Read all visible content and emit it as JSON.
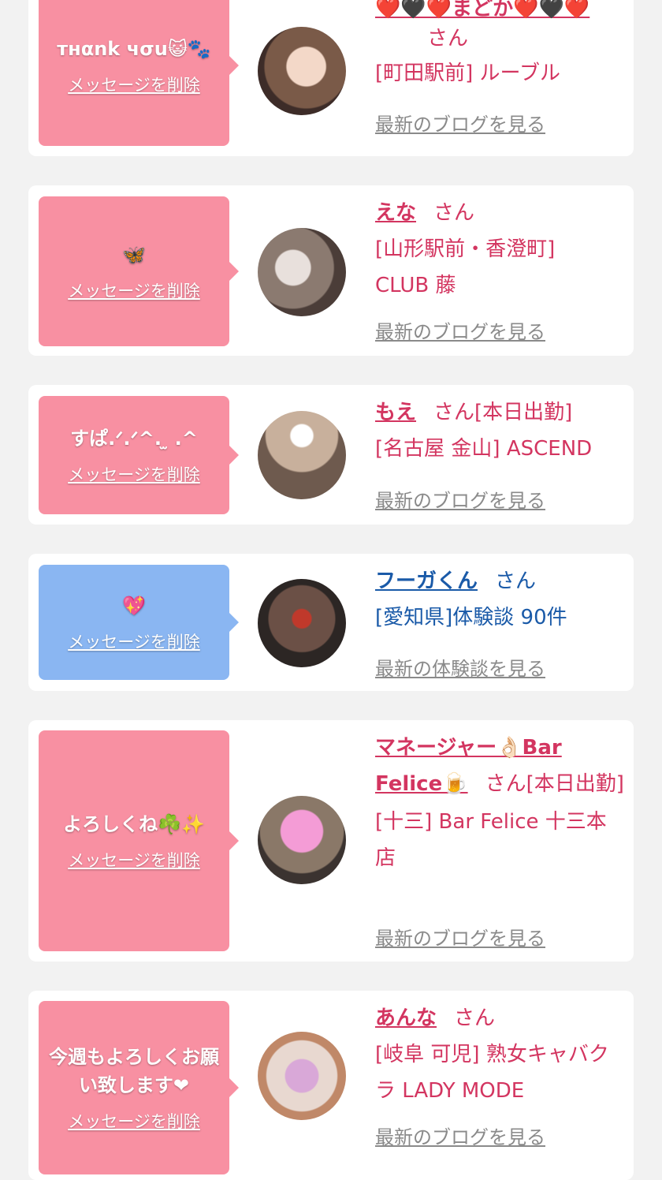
{
  "cards": [
    {
      "message": "тнαnk чσu😺🐾",
      "delete_label": "メッセージを削除",
      "name": "❤️🖤❤️まどか❤️🖤❤️",
      "honorific": "さん",
      "status": "",
      "shop": "[町田駅前] ルーブル",
      "link": "最新のブログを見る"
    },
    {
      "message": "🦋",
      "delete_label": "メッセージを削除",
      "name": "えな",
      "honorific": "さん",
      "status": "",
      "shop": "[山形駅前・香澄町] CLUB 藤",
      "link": "最新のブログを見る"
    },
    {
      "message": "すぱ.ᐟ.ᐟ^. ̫ .^",
      "delete_label": "メッセージを削除",
      "name": "もえ",
      "honorific": "さん",
      "status": "[本日出勤]",
      "shop": "[名古屋 金山] ASCEND",
      "link": "最新のブログを見る"
    },
    {
      "message": "💖",
      "delete_label": "メッセージを削除",
      "name": "フーガくん",
      "honorific": "さん",
      "status": "",
      "shop": "[愛知県]体験談 90件",
      "link": "最新の体験談を見る"
    },
    {
      "message": "よろしくね☘️✨",
      "delete_label": "メッセージを削除",
      "name": "マネージャー👌🏻Bar Felice🍺",
      "honorific": "さん",
      "status": "[本日出勤]",
      "shop": "[十三] Bar Felice 十三本店",
      "link": "最新のブログを見る"
    },
    {
      "message": "今週もよろしくお願い致します❤︎",
      "delete_label": "メッセージを削除",
      "name": "あんな",
      "honorific": "さん",
      "status": "",
      "shop": "[岐阜 可児] 熟女キャバクラ LADY MODE",
      "link": "最新のブログを見る"
    }
  ],
  "colors": {
    "bubble_pink": "#f890a2",
    "bubble_blue": "#8ab6f2",
    "cast_text": "#d33560",
    "user_text": "#1a5aa8",
    "link_gray": "#8a8a8a",
    "page_bg": "#f2f2f2"
  }
}
